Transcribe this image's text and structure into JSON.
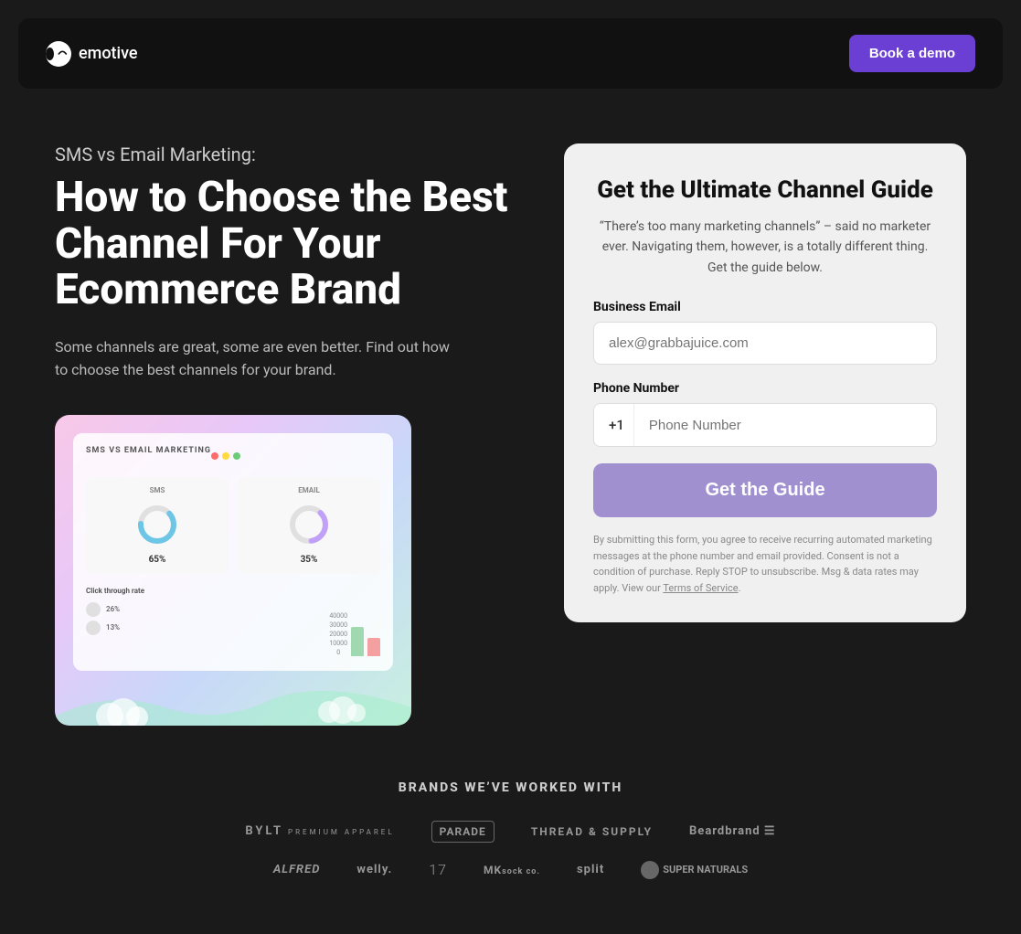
{
  "header": {
    "logo_text": "emotive",
    "book_demo_label": "Book a demo"
  },
  "hero": {
    "subtitle": "SMS vs Email Marketing:",
    "title": "How to Choose the Best Channel For Your Ecommerce Brand",
    "description": "Some channels are great, some are even better. Find out how to choose the best channels for your brand.",
    "preview": {
      "header_label": "SMS VS EMAIL MARKETING",
      "col1_label": "SMS",
      "col1_pct": "65%",
      "col2_label": "EMAIL",
      "col2_pct": "35%",
      "ctr_label": "Click through rate",
      "row1_pct": "26%",
      "row2_pct": "13%"
    }
  },
  "form": {
    "title": "Get the Ultimate Channel Guide",
    "description": "“There’s too many marketing channels” – said no marketer ever. Navigating them, however, is a totally different thing. Get the guide below.",
    "email_label": "Business Email",
    "email_placeholder": "alex@grabbajuice.com",
    "phone_label": "Phone Number",
    "phone_prefix": "+1",
    "phone_placeholder": "Phone Number",
    "submit_label": "Get the Guide",
    "disclaimer": "By submitting this form, you agree to receive recurring automated marketing messages at the phone number and email provided. Consent is not a condition of purchase. Reply STOP to unsubscribe. Msg & data rates may apply. View our ",
    "tos_label": "Terms of Service",
    "tos_url": "#"
  },
  "brands": {
    "section_title": "BRANDS WE’VE WORKED WITH",
    "row1": [
      "BYLT",
      "PARADE",
      "THREAD & SUPPLY",
      "Beardbrand"
    ],
    "row2": [
      "ALFRED",
      "welly.",
      "17",
      "MKsock co.",
      "split",
      "SUPER NATURALS"
    ]
  }
}
